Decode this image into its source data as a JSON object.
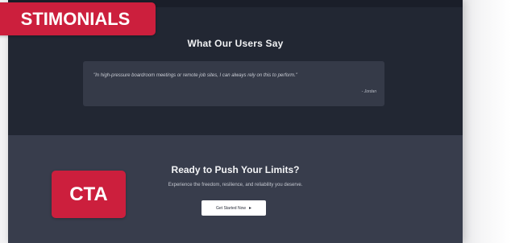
{
  "testimonials": {
    "heading": "What Our Users Say",
    "quote": "\"In high-pressure boardroom meetings or remote job sites, I can always rely on this to perform.\"",
    "author": "- Jordan"
  },
  "cta": {
    "heading": "Ready to Push Your Limits?",
    "subtext": "Experience the freedom, resilience, and reliability you deserve.",
    "button_label": "Get Started Now",
    "button_icon": "arrow-right-icon"
  },
  "labels": {
    "testimonials": "STIMONIALS",
    "cta": "CTA"
  },
  "colors": {
    "badge": "#cc1f3d",
    "testimonials_bg": "#222733",
    "cta_bg": "#383d4c",
    "quote_card": "#353a48"
  }
}
